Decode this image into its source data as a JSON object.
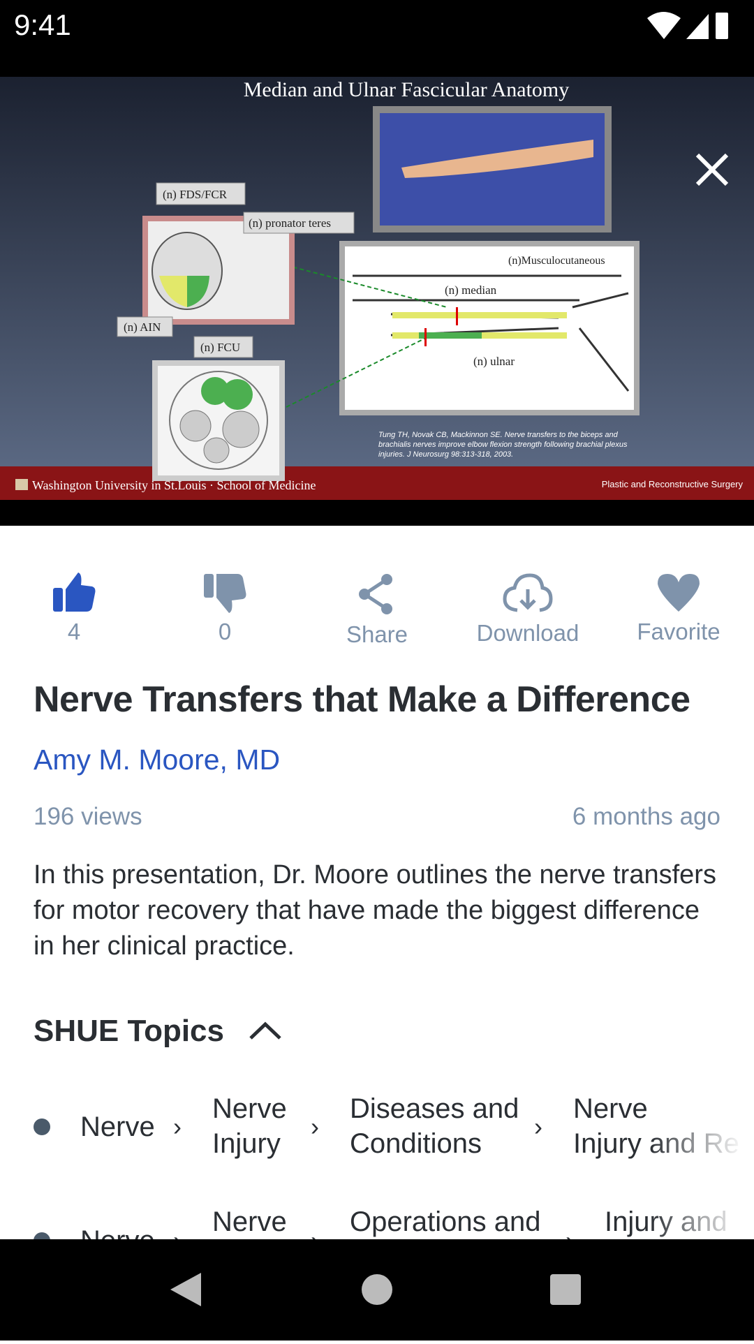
{
  "status_bar": {
    "time": "9:41"
  },
  "video": {
    "slide_title": "Median and Ulnar Fascicular Anatomy",
    "labels": {
      "fds_fcr": "(n) FDS/FCR",
      "pronator": "(n) pronator teres",
      "ain": "(n) AIN",
      "fcu": "(n) FCU",
      "musculo": "(n)Musculocutaneous",
      "median": "(n) median",
      "ulnar": "(n) ulnar"
    },
    "citation": [
      "Tung TH, Novak CB, Mackinnon SE. Nerve transfers to the biceps and",
      "brachialis nerves improve elbow flexion strength following brachial plexus",
      "injuries. J Neurosurg 98:313-318, 2003."
    ],
    "footer_left": "Washington University in St.Louis · School of Medicine",
    "footer_right": "Plastic and Reconstructive Surgery",
    "close_icon": "close-icon"
  },
  "actions": {
    "like_count": "4",
    "dislike_count": "0",
    "share": "Share",
    "download": "Download",
    "favorite": "Favorite",
    "like_color": "#2a56c1",
    "muted_color": "#7f93ab"
  },
  "video_title": "Nerve Transfers that Make a Difference",
  "author": "Amy M. Moore, MD",
  "views": "196 views",
  "posted": "6 months ago",
  "description": "In this presentation, Dr. Moore outlines the nerve transfers for motor recovery that have made the biggest difference in her clinical practice.",
  "topics": {
    "heading": "SHUE Topics",
    "rows": [
      {
        "items": [
          "Nerve",
          "Nerve",
          "Injury",
          "Diseases and",
          "Conditions",
          "Nerve",
          "Injury and Re"
        ]
      },
      {
        "items": [
          "Nerve",
          "Nerve",
          "Operations and",
          "Injury and"
        ]
      }
    ]
  }
}
